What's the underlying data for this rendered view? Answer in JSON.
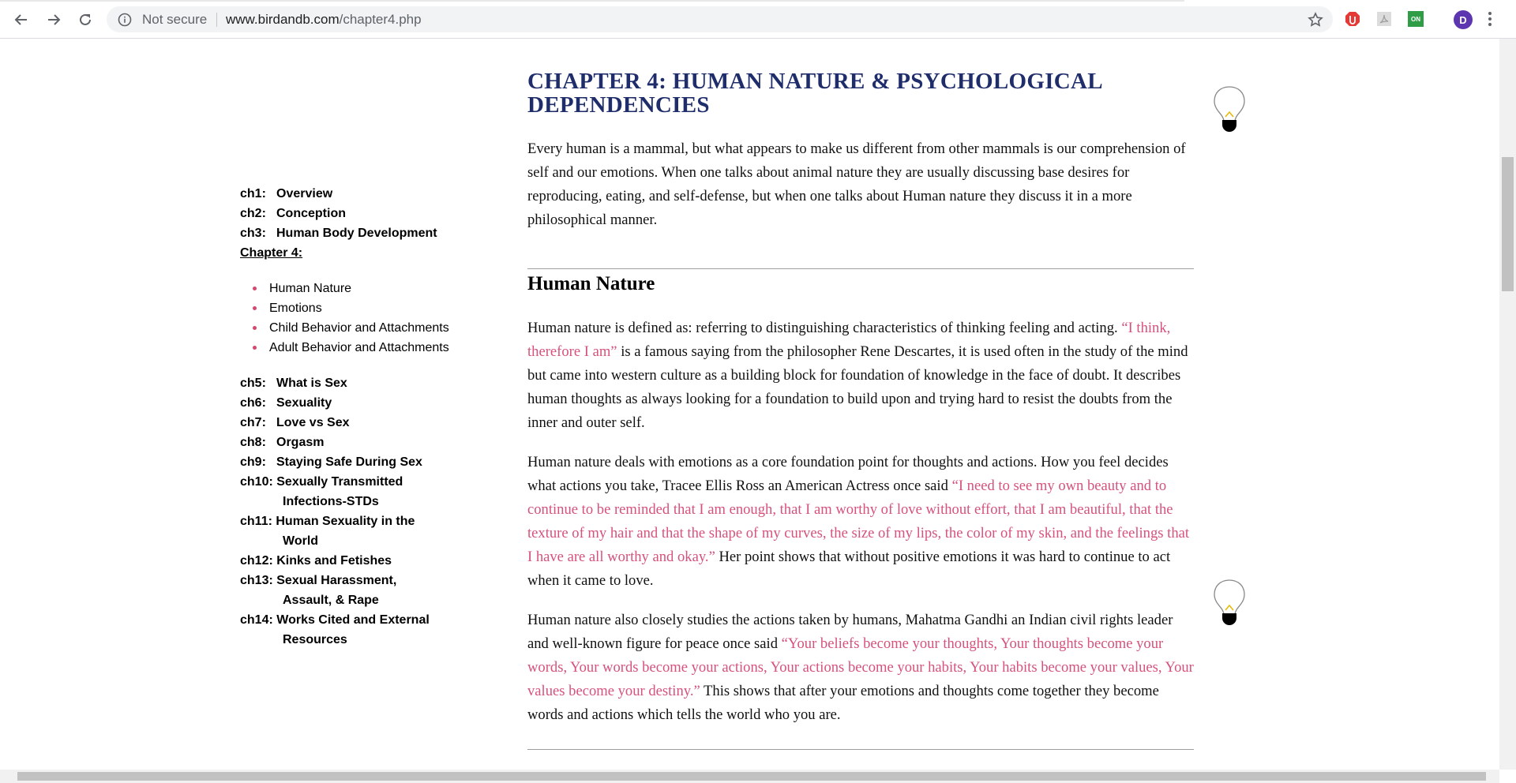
{
  "browser": {
    "security_label": "Not secure",
    "url_domain": "www.birdandb.com",
    "url_path": "/chapter4.php",
    "profile_initial": "D",
    "extension_badge": "ON"
  },
  "sidebar": {
    "chapters_before": [
      {
        "num": "ch1:",
        "title": "Overview"
      },
      {
        "num": "ch2:",
        "title": "Conception"
      },
      {
        "num": "ch3:",
        "title": "Human Body Development"
      }
    ],
    "current_label": "Chapter 4:",
    "sub_items": [
      "Human Nature",
      "Emotions",
      "Child Behavior and Attachments",
      "Adult Behavior and Attachments"
    ],
    "chapters_after": [
      {
        "num": "ch5:",
        "title": "What is Sex"
      },
      {
        "num": "ch6:",
        "title": "Sexuality"
      },
      {
        "num": "ch7:",
        "title": "Love vs Sex"
      },
      {
        "num": "ch8:",
        "title": "Orgasm"
      },
      {
        "num": "ch9:",
        "title": "Staying Safe During Sex"
      }
    ],
    "chapters_multi": [
      {
        "num": "ch10:",
        "title": "Sexually Transmitted",
        "cont": "Infections-STDs"
      },
      {
        "num": "ch11:",
        "title": "Human Sexuality in the",
        "cont": "World"
      },
      {
        "num": "ch12:",
        "title": "Kinks and Fetishes",
        "cont": ""
      },
      {
        "num": "ch13:",
        "title": "Sexual Harassment,",
        "cont": "Assault, & Rape"
      },
      {
        "num": "ch14:",
        "title": "Works Cited and External",
        "cont": "Resources"
      }
    ]
  },
  "main": {
    "title": "CHAPTER 4: HUMAN NATURE & PSYCHOLOGICAL DEPENDENCIES",
    "intro": "Every human is a mammal, but what appears to make us different from other mammals is our comprehension of self and our emotions. When one talks about animal nature they are usually discussing base desires for reproducing, eating, and self-defense, but when one talks about Human nature they discuss it in a more philosophical manner.",
    "section_heading": "Human Nature",
    "p1_a": "Human nature is defined as: referring to distinguishing characteristics of thinking feeling and acting. ",
    "p1_quote": "“I think, therefore I am”",
    "p1_b": " is a famous saying from the philosopher Rene Descartes, it is used often in the study of the mind but came into western culture as a building block for foundation of knowledge in the face of doubt. It describes human thoughts as always looking for a foundation to build upon and trying hard to resist the doubts from the inner and outer self.",
    "p2_a": "Human nature deals with emotions as a core foundation point for thoughts and actions. How you feel decides what actions you take, Tracee Ellis Ross an American Actress once said ",
    "p2_quote": "“I need to see my own beauty and to continue to be reminded that I am enough, that I am worthy of love without effort, that I am beautiful, that the texture of my hair and that the shape of my curves, the size of my lips, the color of my skin, and the feelings that I have are all worthy and okay.”",
    "p2_b": " Her point shows that without positive emotions it was hard to continue to act when it came to love.",
    "p3_a": "Human nature also closely studies the actions taken by humans, Mahatma Gandhi an Indian civil rights leader and well-known figure for peace once said ",
    "p3_quote": "“Your beliefs become your thoughts, Your thoughts become your words, Your words become your actions, Your actions become your habits, Your habits become your values, Your values become your destiny.”",
    "p3_b": " This shows that after your emotions and thoughts come together they become words and actions which tells the world who you are."
  },
  "colors": {
    "title": "#1f2d6b",
    "quote": "#d6527b",
    "bullet": "#d64870"
  }
}
